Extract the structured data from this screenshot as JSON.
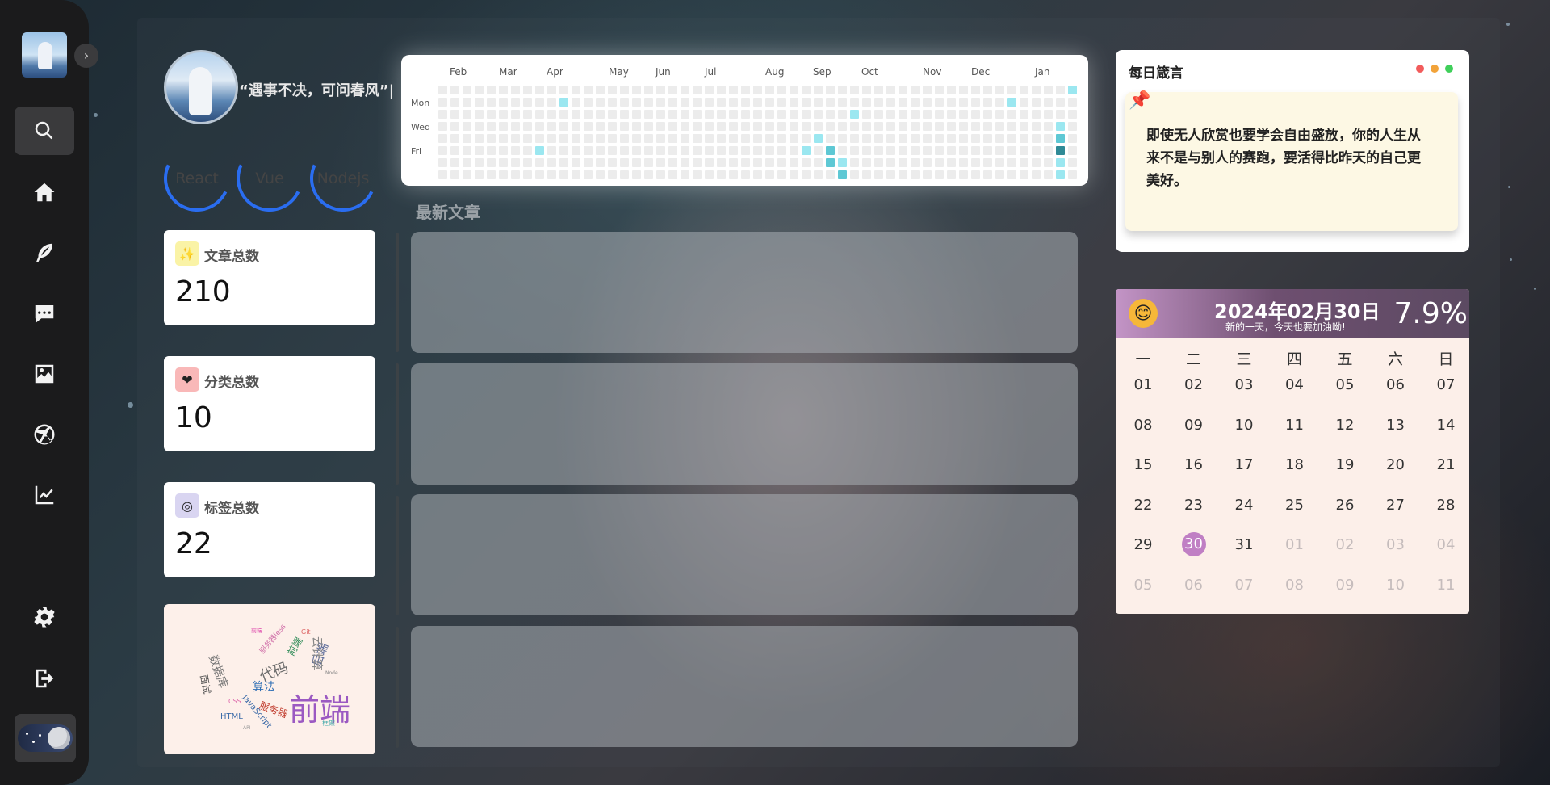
{
  "profile": {
    "motto": "“遇事不决，可问春风”|",
    "skills": [
      "React",
      "Vue",
      "Nodejs"
    ]
  },
  "sidebar": {
    "icons": [
      "search-icon",
      "home-icon",
      "feather-icon",
      "chat-icon",
      "image-icon",
      "aperture-icon",
      "chart-icon",
      "settings-icon",
      "logout-icon"
    ],
    "expand_label": "›"
  },
  "stats": [
    {
      "title": "文章总数",
      "value": "210",
      "icon": "sparkles-icon",
      "icon_glyph": "✨",
      "icon_bg": "#faf3a6"
    },
    {
      "title": "分类总数",
      "value": "10",
      "icon": "heart-icon",
      "icon_glyph": "❤",
      "icon_bg": "#f9b8b8"
    },
    {
      "title": "标签总数",
      "value": "22",
      "icon": "target-icon",
      "icon_glyph": "◎",
      "icon_bg": "#d9d5f1"
    }
  ],
  "wordcloud": {
    "words": [
      "前端",
      "代码",
      "算法",
      "数据库",
      "服务器",
      "后端",
      "云计算",
      "HTML",
      "JavaScript",
      "服务器less",
      "前端",
      "面试",
      "Git",
      "框架",
      "前端",
      "Node",
      "CSS",
      "API"
    ]
  },
  "contrib": {
    "months": [
      "Feb",
      "Mar",
      "Apr",
      "May",
      "Jun",
      "Jul",
      "Aug",
      "Sep",
      "Oct",
      "Nov",
      "Dec",
      "Jan"
    ],
    "weekdays": [
      "Mon",
      "Wed",
      "Fri"
    ],
    "colors": {
      "empty": "#ececec",
      "l1": "#9be7f0",
      "l2": "#5ec8d4",
      "l3": "#2f8a96"
    }
  },
  "latest": {
    "title": "最新文章"
  },
  "quote": {
    "title": "每日箴言",
    "text": "即使无人欣赏也要学会自由盛放，你的人生从来不是与别人的赛跑，要活得比昨天的自己更美好。",
    "dot_colors": [
      "#f25c5c",
      "#f2a33a",
      "#3fcf5a"
    ]
  },
  "calendar": {
    "date": "2024年02月30日",
    "subtitle": "新的一天，今天也要加油呦!",
    "percent": "7.9%",
    "weekdays": [
      "一",
      "二",
      "三",
      "四",
      "五",
      "六",
      "日"
    ],
    "days": [
      "01",
      "02",
      "03",
      "04",
      "05",
      "06",
      "07",
      "08",
      "09",
      "10",
      "11",
      "12",
      "13",
      "14",
      "15",
      "16",
      "17",
      "18",
      "19",
      "20",
      "21",
      "22",
      "23",
      "24",
      "25",
      "26",
      "27",
      "28",
      "29",
      "30",
      "31",
      "01",
      "02",
      "03",
      "04",
      "05",
      "06",
      "07",
      "08",
      "09",
      "10",
      "11"
    ],
    "today_index": 29,
    "muted_from": 31
  }
}
